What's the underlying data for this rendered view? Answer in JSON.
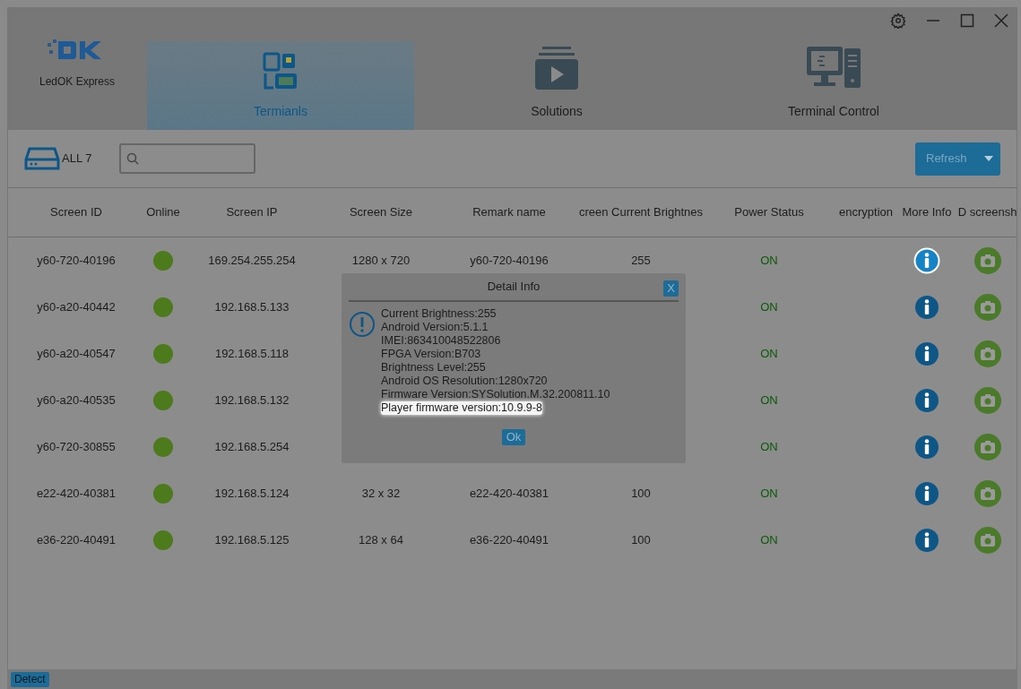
{
  "app": {
    "name": "LedOK Express"
  },
  "nav_tabs": [
    {
      "label": "Termianls",
      "kind": "terminals",
      "selected": true
    },
    {
      "label": "Solutions",
      "kind": "solutions",
      "selected": false
    },
    {
      "label": "Terminal Control",
      "kind": "control",
      "selected": false
    }
  ],
  "toolbar": {
    "count_label": "ALL 7",
    "refresh_button": "Refresh"
  },
  "table": {
    "columns": [
      "Screen ID",
      "Online",
      "Screen IP",
      "Screen Size",
      "Remark name",
      "creen Current Brightnes",
      "Power Status",
      "encryption",
      "More Info",
      "D screensh"
    ],
    "rows": [
      {
        "id": "y60-720-40196",
        "online": true,
        "ip": "169.254.255.254",
        "size": "1280 x 720",
        "remark": "y60-720-40196",
        "brightness": "255",
        "power": "ON",
        "selected": true
      },
      {
        "id": "y60-a20-40442",
        "online": true,
        "ip": "192.168.5.133",
        "power": "ON",
        "selected": false
      },
      {
        "id": "y60-a20-40547",
        "online": true,
        "ip": "192.168.5.118",
        "power": "ON",
        "selected": false
      },
      {
        "id": "y60-a20-40535",
        "online": true,
        "ip": "192.168.5.132",
        "power": "ON",
        "selected": false
      },
      {
        "id": "y60-720-30855",
        "online": true,
        "ip": "192.168.5.254",
        "power": "ON",
        "selected": false
      },
      {
        "id": "e22-420-40381",
        "online": true,
        "ip": "192.168.5.124",
        "size": "32 x 32",
        "remark": "e22-420-40381",
        "brightness": "100",
        "power": "ON",
        "selected": false
      },
      {
        "id": "e36-220-40491",
        "online": true,
        "ip": "192.168.5.125",
        "size": "128 x 64",
        "remark": "e36-220-40491",
        "brightness": "100",
        "power": "ON",
        "selected": false
      }
    ]
  },
  "dialog": {
    "title": "Detail Info",
    "close": "X",
    "lines": [
      {
        "text": "Current Brightness:255",
        "highlighted": false
      },
      {
        "text": "Android Version:5.1.1",
        "highlighted": false
      },
      {
        "text": "IMEI:863410048522806",
        "highlighted": false
      },
      {
        "text": "FPGA Version:B703",
        "highlighted": false
      },
      {
        "text": "Brightness Level:255",
        "highlighted": false
      },
      {
        "text": "Android OS Resolution:1280x720",
        "highlighted": false
      },
      {
        "text": "Firmware Version:SYSolution.M.32.200811.10",
        "highlighted": false
      },
      {
        "text": "Player firmware version:10.9.9-8",
        "highlighted": true
      }
    ],
    "ok_button": "Ok"
  },
  "status_bar": {
    "detect_button": "Detect"
  }
}
